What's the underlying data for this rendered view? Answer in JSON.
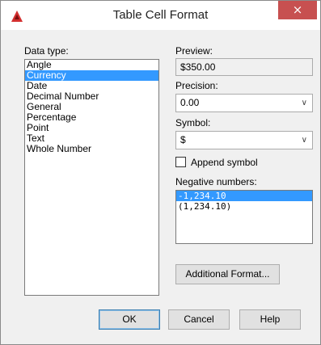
{
  "window": {
    "title": "Table Cell Format",
    "close_symbol": "×",
    "icon": "autocad-app-icon"
  },
  "data_type": {
    "label": "Data type:",
    "items": [
      "Angle",
      "Currency",
      "Date",
      "Decimal Number",
      "General",
      "Percentage",
      "Point",
      "Text",
      "Whole Number"
    ],
    "selected": "Currency"
  },
  "preview": {
    "label": "Preview:",
    "value": "$350.00"
  },
  "precision": {
    "label": "Precision:",
    "value": "0.00"
  },
  "symbol": {
    "label": "Symbol:",
    "value": "$"
  },
  "append_symbol": {
    "label": "Append symbol",
    "checked": false
  },
  "negative_numbers": {
    "label": "Negative numbers:",
    "items": [
      "-1,234.10",
      "(1,234.10)"
    ],
    "selected": "-1,234.10"
  },
  "buttons": {
    "additional_format": "Additional Format...",
    "ok": "OK",
    "cancel": "Cancel",
    "help": "Help"
  },
  "colors": {
    "selection": "#3399ff",
    "close_button": "#c75050",
    "brand_red": "#d32f2f"
  }
}
